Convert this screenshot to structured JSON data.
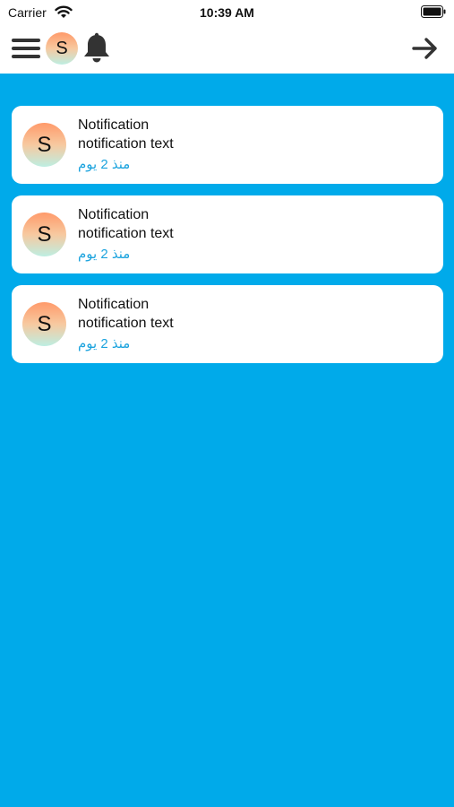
{
  "status_bar": {
    "carrier": "Carrier",
    "time": "10:39 AM"
  },
  "nav": {
    "avatar_letter": "S"
  },
  "notifications": [
    {
      "avatar_letter": "S",
      "title": "Notification",
      "text": "notification text",
      "time": "منذ 2 يوم"
    },
    {
      "avatar_letter": "S",
      "title": "Notification",
      "text": "notification text",
      "time": "منذ 2 يوم"
    },
    {
      "avatar_letter": "S",
      "title": "Notification",
      "text": "notification text",
      "time": "منذ 2 يوم"
    }
  ],
  "colors": {
    "background": "#00aaea",
    "card": "#ffffff",
    "time_text": "#1ba3de",
    "icon": "#333333"
  },
  "icons": {
    "menu": "hamburger-menu-icon",
    "bell": "bell-icon",
    "arrow": "arrow-right-icon"
  }
}
